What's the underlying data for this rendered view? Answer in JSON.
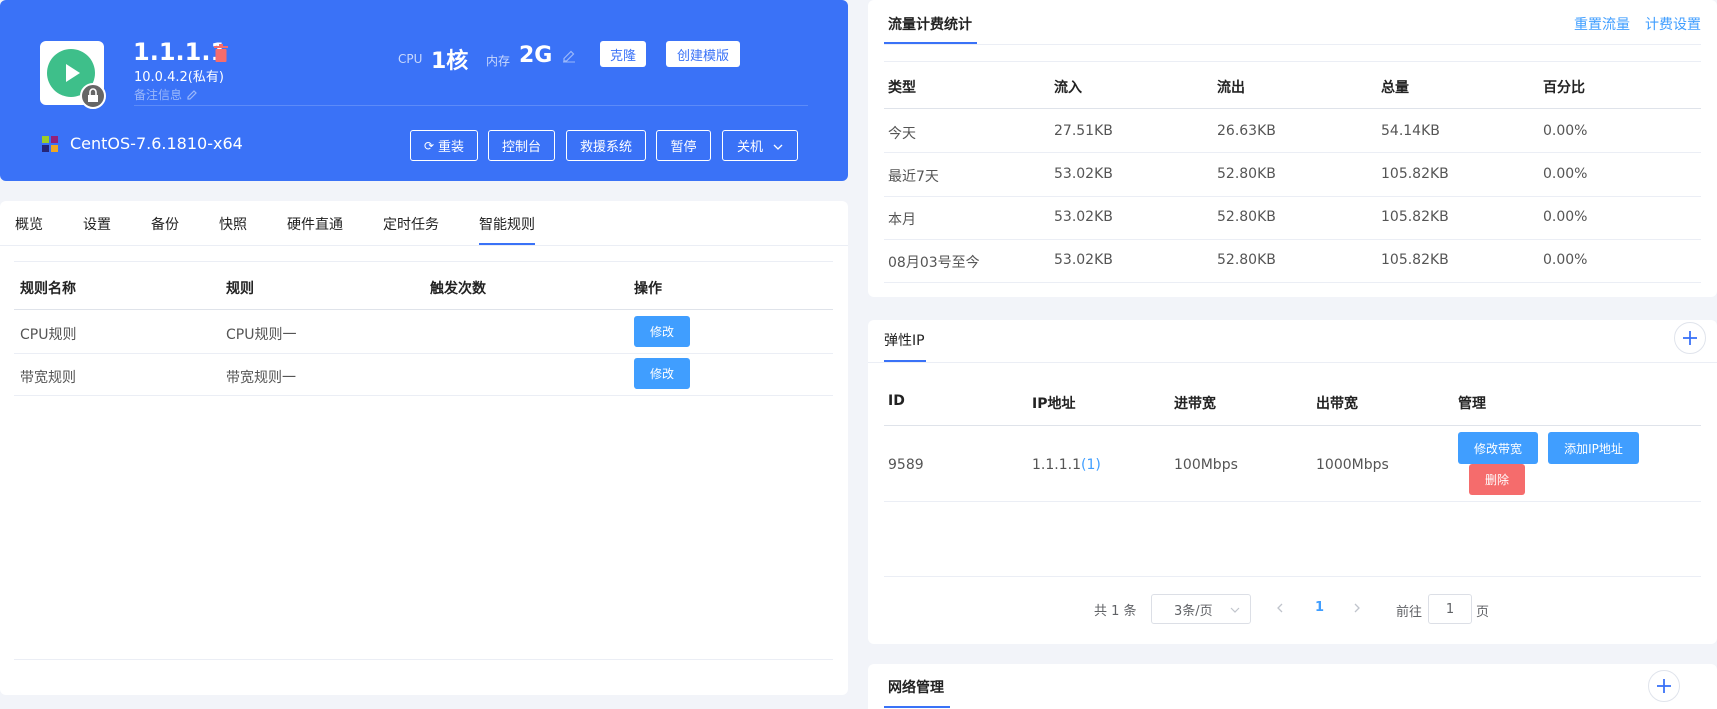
{
  "server": {
    "ip": "1.1.1.1",
    "private_ip": "10.0.4.2(私有)",
    "remark_placeholder": "备注信息",
    "cpu_label": "CPU",
    "cpu_value": "1核",
    "mem_label": "内存",
    "mem_value": "2G",
    "clone_label": "克隆",
    "template_label": "创建模版",
    "os": "CentOS-7.6.1810-x64",
    "actions": {
      "reinstall": "重装",
      "console": "控制台",
      "rescue": "救援系统",
      "pause": "暂停",
      "shutdown": "关机"
    },
    "status_color": "#3ebf8a",
    "banner_color": "#3a72f7"
  },
  "tabs": [
    "概览",
    "设置",
    "备份",
    "快照",
    "硬件直通",
    "定时任务",
    "智能规则"
  ],
  "active_tab": "智能规则",
  "rules": {
    "headers": [
      "规则名称",
      "规则",
      "触发次数",
      "操作"
    ],
    "rows": [
      {
        "name": "CPU规则",
        "rule": "CPU规则一",
        "count": "",
        "action": "修改"
      },
      {
        "name": "带宽规则",
        "rule": "带宽规则一",
        "count": "",
        "action": "修改"
      }
    ]
  },
  "traffic": {
    "title": "流量计费统计",
    "reset_link": "重置流量",
    "billing_link": "计费设置",
    "headers": [
      "类型",
      "流入",
      "流出",
      "总量",
      "百分比"
    ],
    "rows": [
      [
        "今天",
        "27.51KB",
        "26.63KB",
        "54.14KB",
        "0.00%"
      ],
      [
        "最近7天",
        "53.02KB",
        "52.80KB",
        "105.82KB",
        "0.00%"
      ],
      [
        "本月",
        "53.02KB",
        "52.80KB",
        "105.82KB",
        "0.00%"
      ],
      [
        "08月03号至今",
        "53.02KB",
        "52.80KB",
        "105.82KB",
        "0.00%"
      ]
    ]
  },
  "elastic_ip": {
    "title": "弹性IP",
    "headers": [
      "ID",
      "IP地址",
      "进带宽",
      "出带宽",
      "管理"
    ],
    "row": {
      "id": "9589",
      "ip": "1.1.1.1",
      "ip_count": "(1)",
      "in_bw": "100Mbps",
      "out_bw": "1000Mbps",
      "modify_bw": "修改带宽",
      "add_ip": "添加IP地址",
      "delete": "删除"
    },
    "pagination": {
      "total": "共 1 条",
      "page_size": "3条/页",
      "current": "1",
      "goto_label": "前往",
      "goto_value": "1",
      "page_unit": "页"
    }
  },
  "network": {
    "title": "网络管理"
  }
}
